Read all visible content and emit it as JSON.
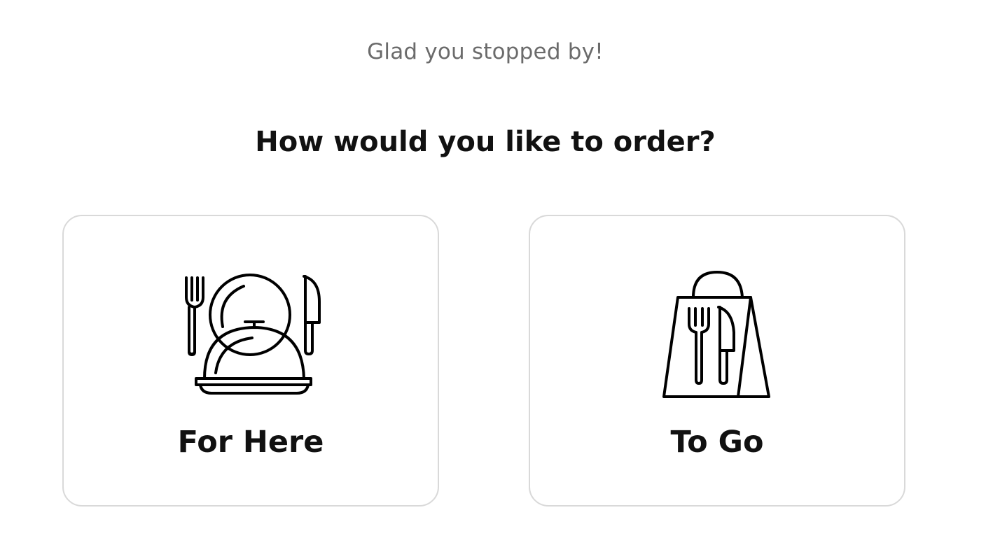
{
  "header": {
    "greeting": "Glad you stopped by!",
    "question": "How would you like to order?"
  },
  "options": [
    {
      "label": "For Here",
      "icon": "dine-in-cloche-icon"
    },
    {
      "label": "To Go",
      "icon": "takeaway-bag-icon"
    }
  ],
  "colors": {
    "background": "#ffffff",
    "greeting_text": "#6b6b6b",
    "heading_text": "#111111",
    "card_border": "#d9d9d9",
    "icon_stroke": "#000000"
  }
}
